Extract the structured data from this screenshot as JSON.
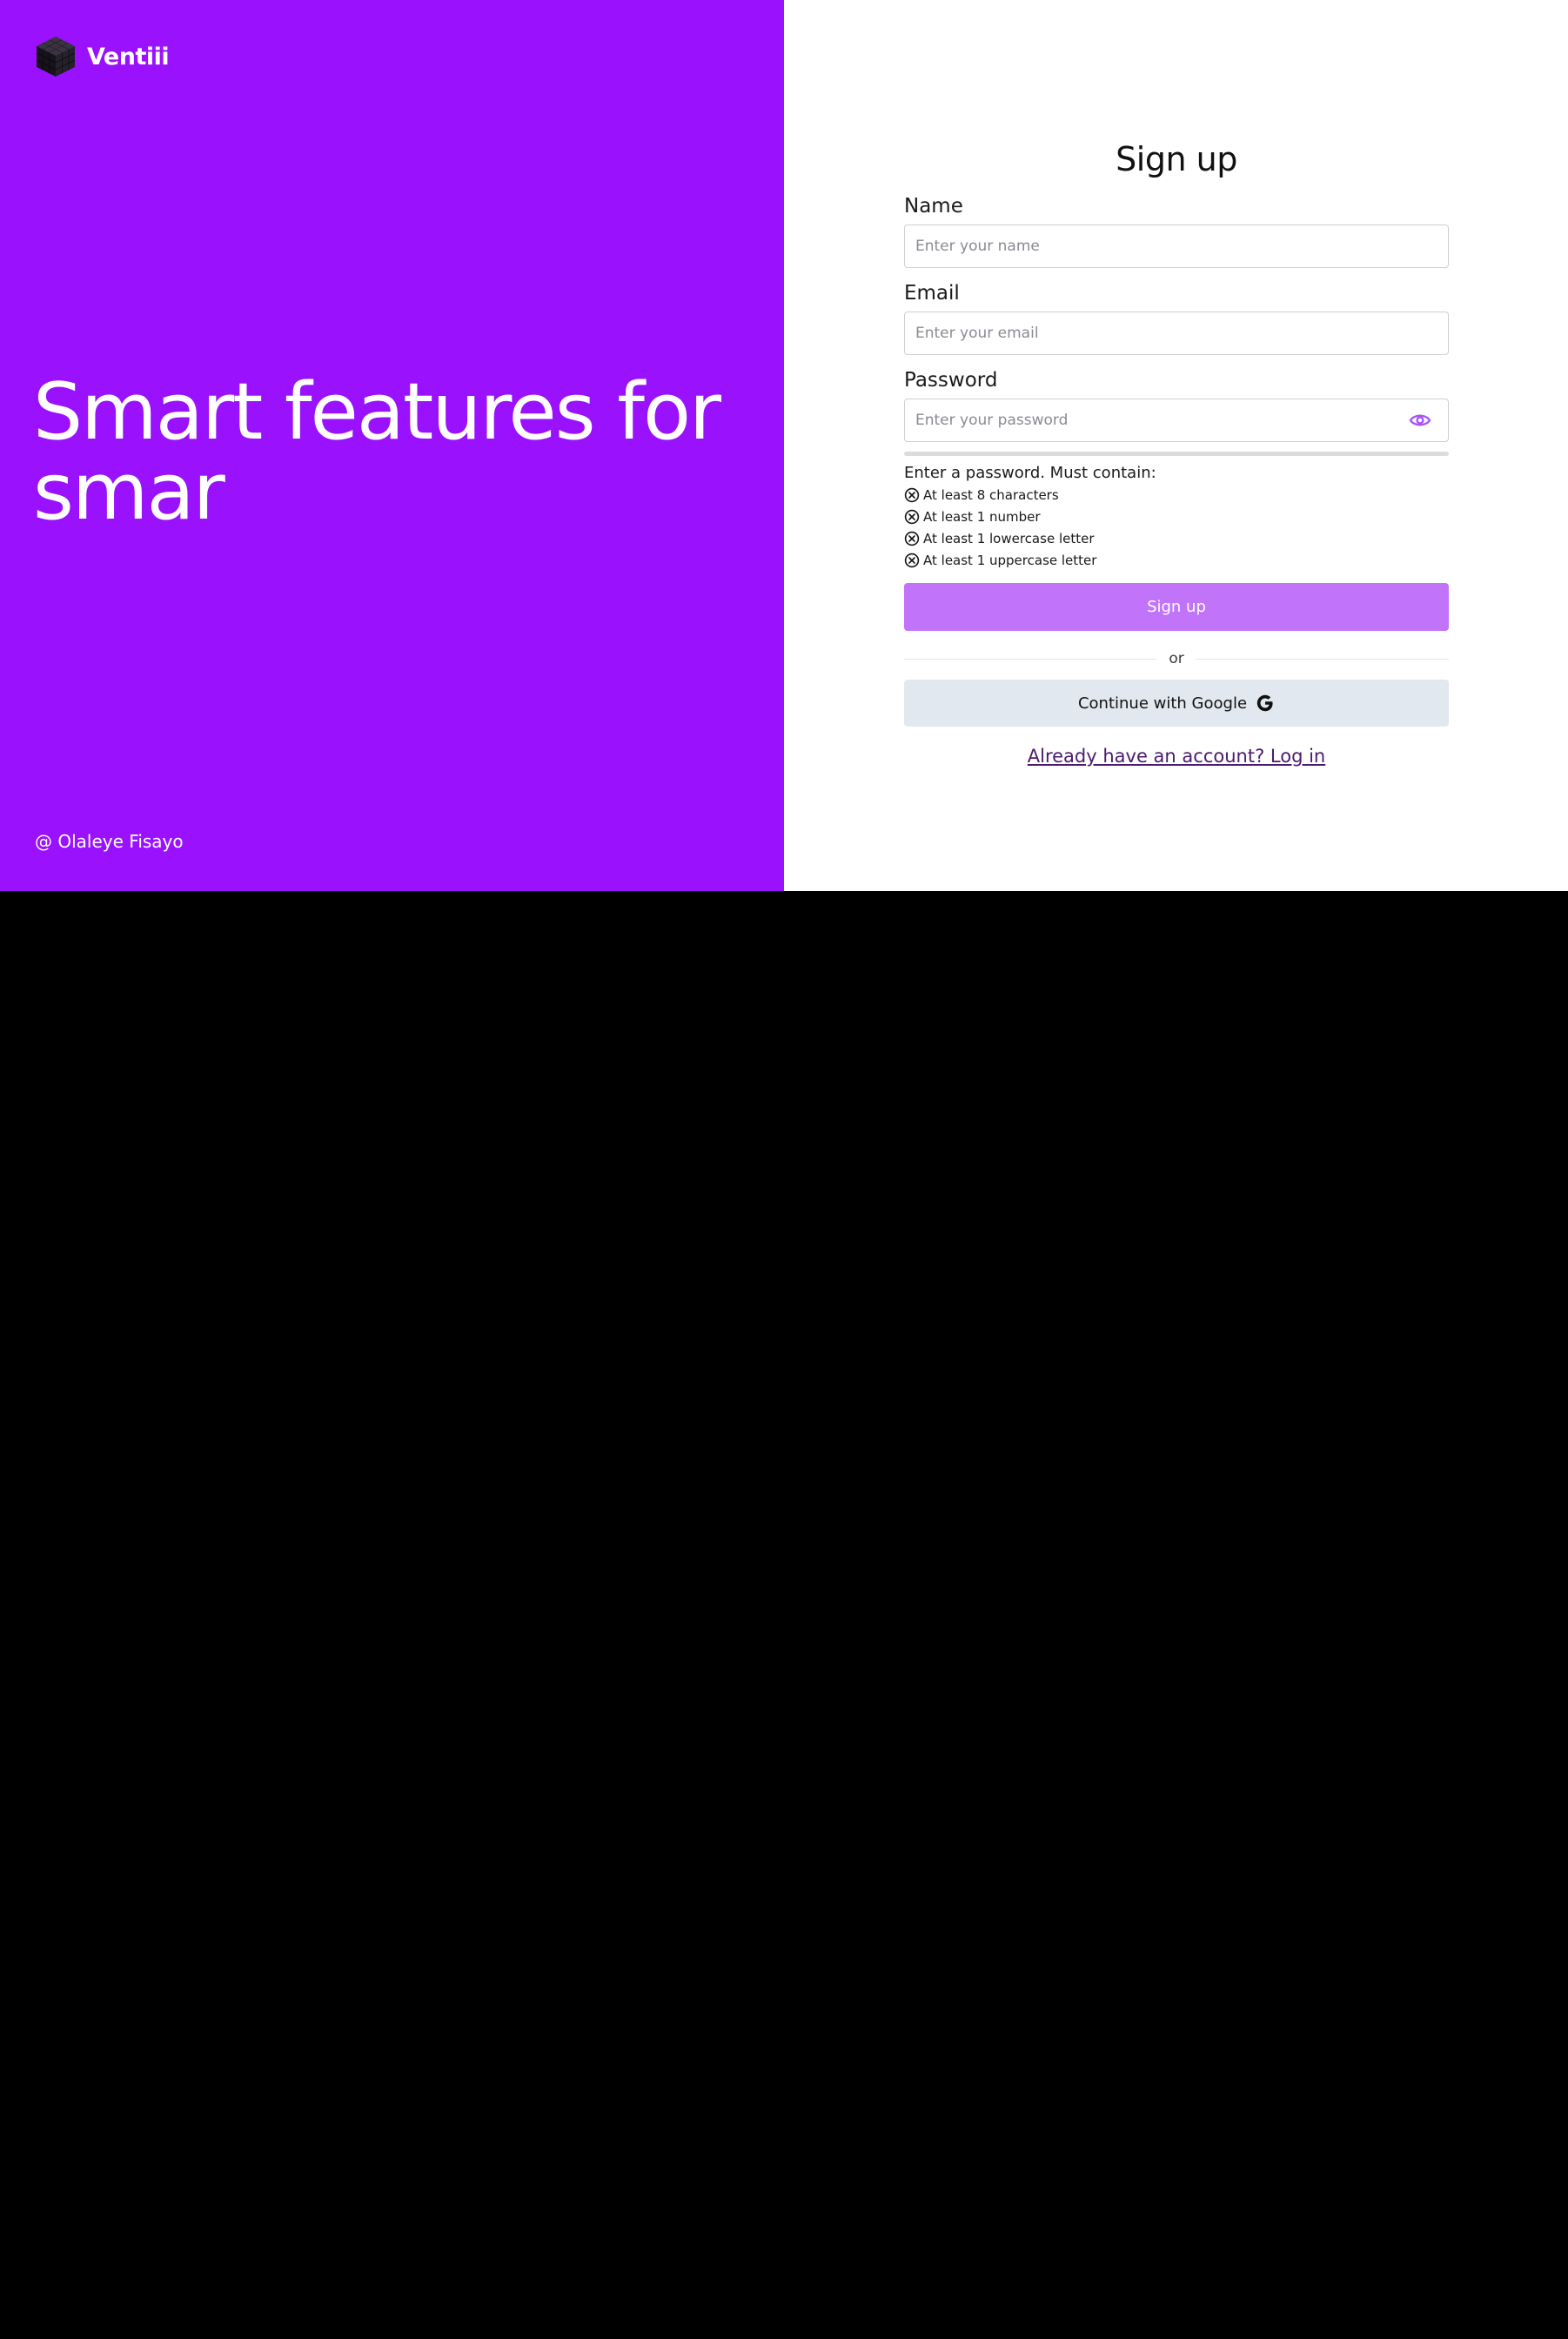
{
  "brand": {
    "name": "Ventiii",
    "logo_icon": "cube-logo-icon"
  },
  "hero": {
    "headline": "Smart features for smar",
    "credit": "@ Olaleye Fisayo",
    "background_color": "#9a11fe"
  },
  "form": {
    "title": "Sign up",
    "name_label": "Name",
    "name_placeholder": "Enter your name",
    "name_value": "",
    "email_label": "Email",
    "email_placeholder": "Enter your email",
    "email_value": "",
    "password_label": "Password",
    "password_placeholder": "Enter your password",
    "password_value": "",
    "password_toggle_icon": "eye-icon",
    "password_strength": 0,
    "requirements_title": "Enter a password. Must contain:",
    "requirements": [
      {
        "label": "At least 8 characters",
        "icon": "x-circle-icon",
        "met": false
      },
      {
        "label": "At least 1 number",
        "icon": "x-circle-icon",
        "met": false
      },
      {
        "label": "At least 1 lowercase letter",
        "icon": "x-circle-icon",
        "met": false
      },
      {
        "label": "At least 1 uppercase letter",
        "icon": "x-circle-icon",
        "met": false
      }
    ],
    "submit_label": "Sign up",
    "divider_text": "or",
    "google_label": "Continue with Google",
    "google_icon": "google-icon",
    "login_link": "Already have an account? Log in"
  },
  "colors": {
    "accent": "#9a11fe",
    "button_disabled": "#c174f9",
    "google_button_bg": "#e2e8f0",
    "link": "#4c1a6e"
  }
}
